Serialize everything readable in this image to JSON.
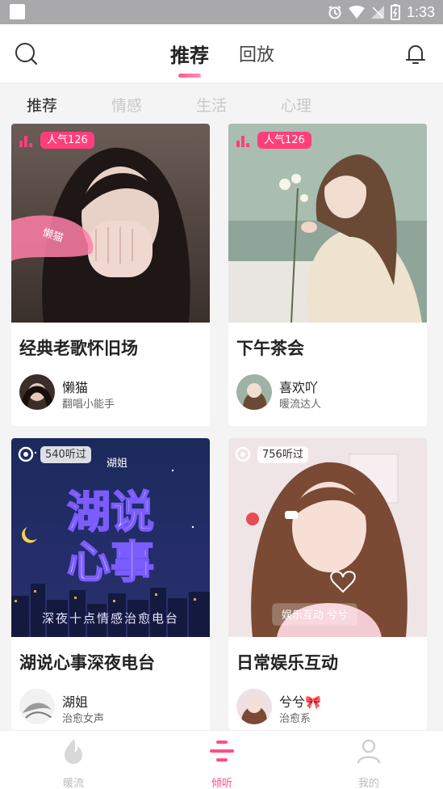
{
  "status_bar": {
    "time": "1:33"
  },
  "header": {
    "tabs": [
      {
        "label": "推荐",
        "active": true
      },
      {
        "label": "回放",
        "active": false
      }
    ]
  },
  "categories": [
    {
      "label": "推荐",
      "active": true
    },
    {
      "label": "情感",
      "active": false
    },
    {
      "label": "生活",
      "active": false
    },
    {
      "label": "心理",
      "active": false
    }
  ],
  "cards": [
    {
      "badge_type": "popularity",
      "badge_text": "人气126",
      "image_overlay_text": "懒猫",
      "title": "经典老歌怀旧场",
      "user_name": "懒猫",
      "user_desc": "翻唱小能手"
    },
    {
      "badge_type": "popularity",
      "badge_text": "人气126",
      "title": "下午茶会",
      "user_name": "喜欢吖",
      "user_desc": "暖流达人"
    },
    {
      "badge_type": "listens",
      "badge_text": "540听过",
      "image_brand": "湖姐",
      "image_title_line1": "湖说",
      "image_title_line2": "心事",
      "image_subtitle": "深夜十点情感治愈电台",
      "title": "湖说心事深夜电台",
      "user_name": "湖姐",
      "user_desc": "治愈女声"
    },
    {
      "badge_type": "listens",
      "badge_text": "756听过",
      "image_overlay_text": "娱乐互动 兮兮",
      "title": "日常娱乐互动",
      "user_name": "兮兮🎀",
      "user_desc": "治愈系"
    }
  ],
  "bottom_nav": [
    {
      "label": "暖流",
      "icon": "flame-icon",
      "active": false
    },
    {
      "label": "倾听",
      "icon": "listen-lines-icon",
      "active": true
    },
    {
      "label": "我的",
      "icon": "person-icon",
      "active": false
    }
  ],
  "colors": {
    "accent": "#ff4f84",
    "popularity_badge": "#ff3f7b"
  }
}
